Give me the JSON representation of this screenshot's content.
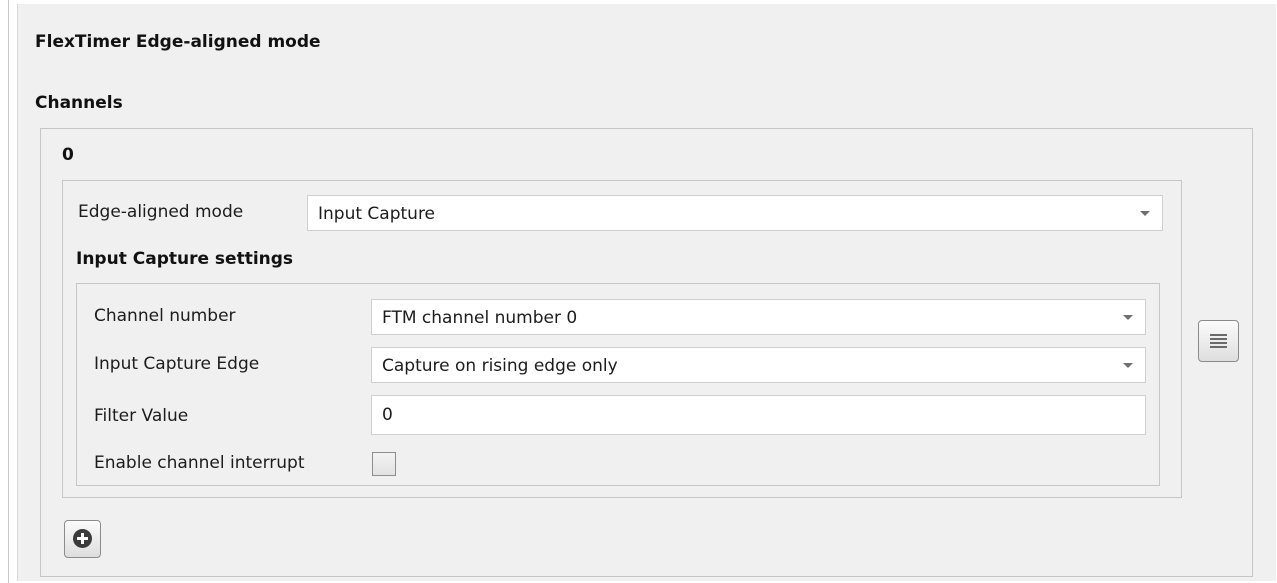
{
  "panel": {
    "title": "FlexTimer Edge-aligned mode"
  },
  "channels": {
    "title": "Channels",
    "items": [
      {
        "index": "0",
        "edge_aligned_mode_label": "Edge-aligned mode",
        "edge_aligned_mode_value": "Input Capture",
        "input_capture_settings_title": "Input Capture settings",
        "channel_number_label": "Channel number",
        "channel_number_value": "FTM channel number 0",
        "input_capture_edge_label": "Input Capture Edge",
        "input_capture_edge_value": "Capture on rising edge only",
        "filter_value_label": "Filter Value",
        "filter_value": "0",
        "enable_channel_interrupt_label": "Enable channel interrupt",
        "enable_channel_interrupt_checked": false
      }
    ]
  },
  "controls": {
    "item_menu_icon": "menu-icon",
    "add_icon": "plus-circle-icon"
  }
}
